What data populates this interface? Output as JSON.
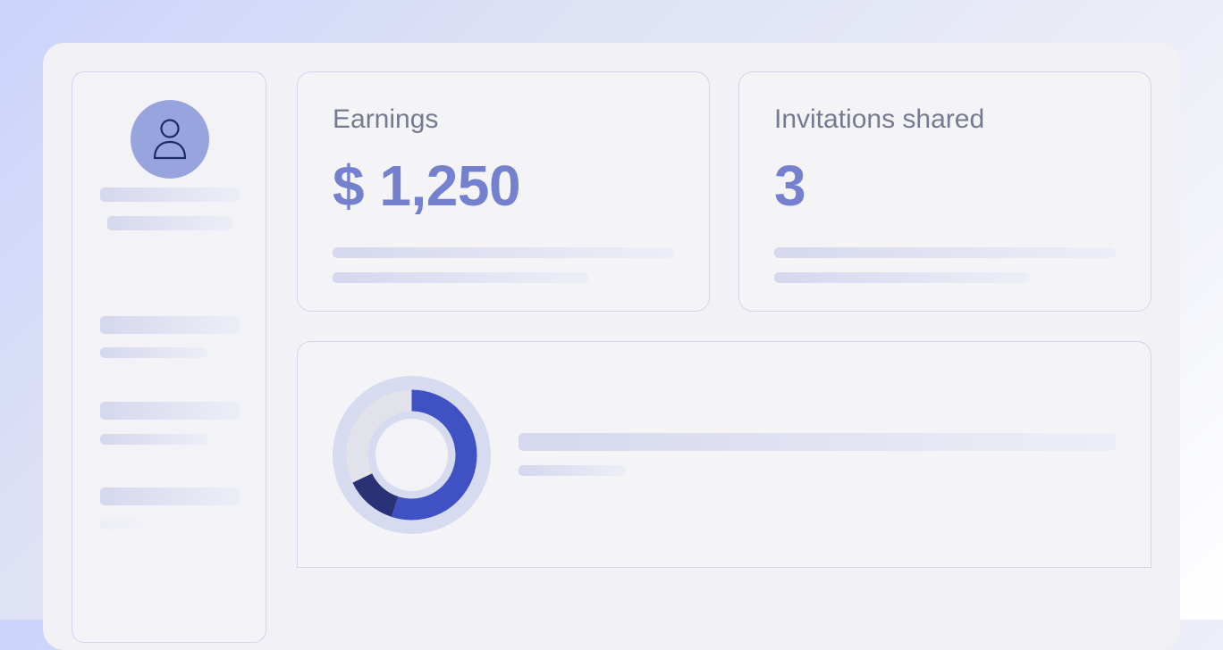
{
  "cards": {
    "earnings": {
      "label": "Earnings",
      "value": "$ 1,250"
    },
    "invitations": {
      "label": "Invitations shared",
      "value": "3"
    }
  },
  "donut": {
    "segments": [
      {
        "fraction": 0.55,
        "color": "#3f51c3"
      },
      {
        "fraction": 0.13,
        "color": "#293275"
      },
      {
        "fraction": 0.32,
        "color": "#e2e3ea"
      }
    ],
    "track_color": "#d6dbf0"
  },
  "icons": {
    "avatar": "user-icon"
  },
  "colors": {
    "accent": "#7381ce",
    "label": "#767a90",
    "avatar_bg": "#98a4dd"
  }
}
